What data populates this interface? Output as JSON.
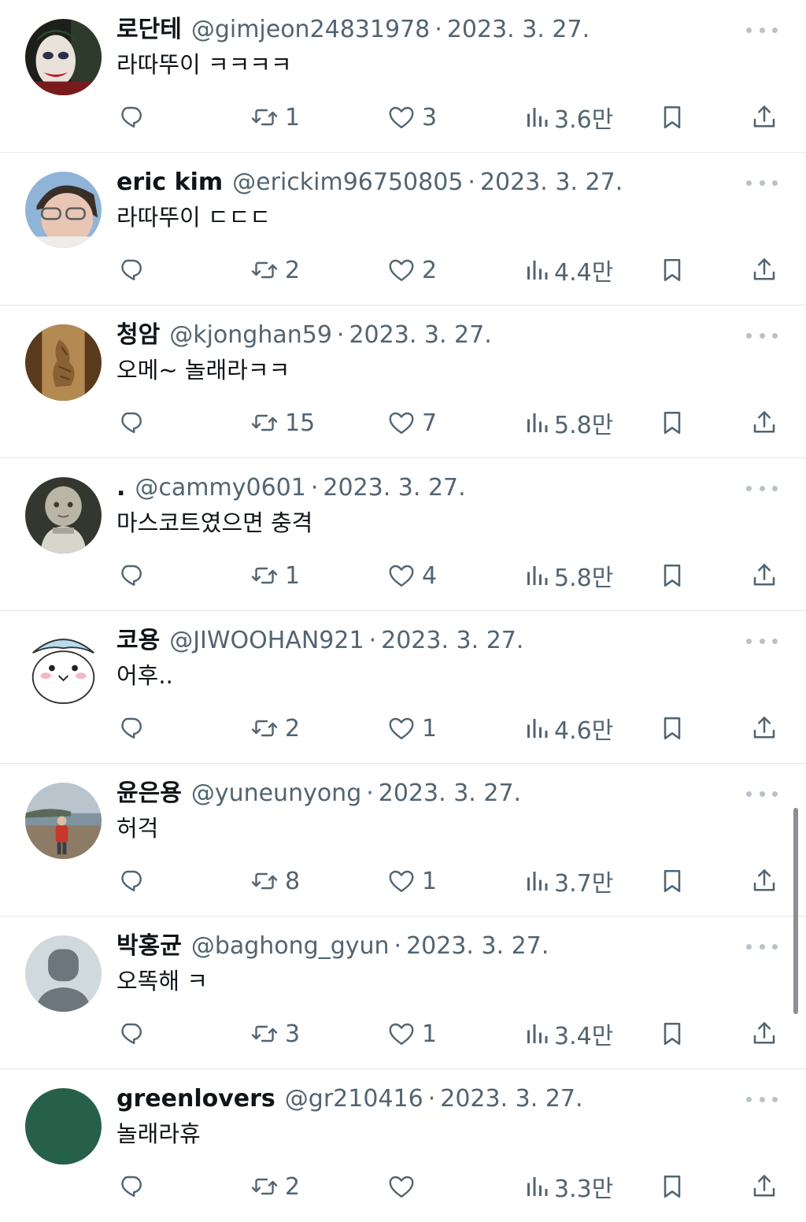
{
  "feed": {
    "tweets": [
      {
        "name": "로단테",
        "handle": "@gimjeon24831978",
        "date": "2023. 3. 27.",
        "text": "라따뚜이 ㅋㅋㅋㅋ",
        "retweets": "1",
        "likes": "3",
        "views": "3.6만",
        "avatar": "joker-portrait"
      },
      {
        "name": "eric kim",
        "handle": "@erickim96750805",
        "date": "2023. 3. 27.",
        "text": "라따뚜이 ㄷㄷㄷ",
        "retweets": "2",
        "likes": "2",
        "views": "4.4만",
        "avatar": "selfie-glasses"
      },
      {
        "name": "청암",
        "handle": "@kjonghan59",
        "date": "2023. 3. 27.",
        "text": "오메~ 놀래라ㅋㅋ",
        "retweets": "15",
        "likes": "7",
        "views": "5.8만",
        "avatar": "old-painting-rooster"
      },
      {
        "name": ".",
        "handle": "@cammy0601",
        "date": "2023. 3. 27.",
        "text": "마스코트였으면 충격",
        "retweets": "1",
        "likes": "4",
        "views": "5.8만",
        "avatar": "doll-figure"
      },
      {
        "name": "코용",
        "handle": "@JIWOOHAN921",
        "date": "2023. 3. 27.",
        "text": "어후..",
        "retweets": "2",
        "likes": "1",
        "views": "4.6만",
        "avatar": "cartoon-character"
      },
      {
        "name": "윤은용",
        "handle": "@yuneunyong",
        "date": "2023. 3. 27.",
        "text": "허걱",
        "retweets": "8",
        "likes": "1",
        "views": "3.7만",
        "avatar": "beach-person"
      },
      {
        "name": "박홍균",
        "handle": "@baghong_gyun",
        "date": "2023. 3. 27.",
        "text": "오똑해 ㅋ",
        "retweets": "3",
        "likes": "1",
        "views": "3.4만",
        "avatar": "default-avatar"
      },
      {
        "name": "greenlovers",
        "handle": "@gr210416",
        "date": "2023. 3. 27.",
        "text": "놀래라휴",
        "retweets": "2",
        "likes": "",
        "views": "3.3만",
        "avatar": "green-circle"
      }
    ],
    "separator": "·"
  },
  "icons": {
    "reply": "reply-icon",
    "retweet": "retweet-icon",
    "like": "heart-icon",
    "views": "views-icon",
    "bookmark": "bookmark-icon",
    "share": "share-icon",
    "more": "more-icon"
  },
  "colors": {
    "text": "#0f1419",
    "muted": "#536471",
    "divider": "#e4e7ea",
    "default_avatar_bg": "#cfd9de",
    "default_avatar_fg": "#6e767d",
    "green_avatar": "#27604a"
  }
}
